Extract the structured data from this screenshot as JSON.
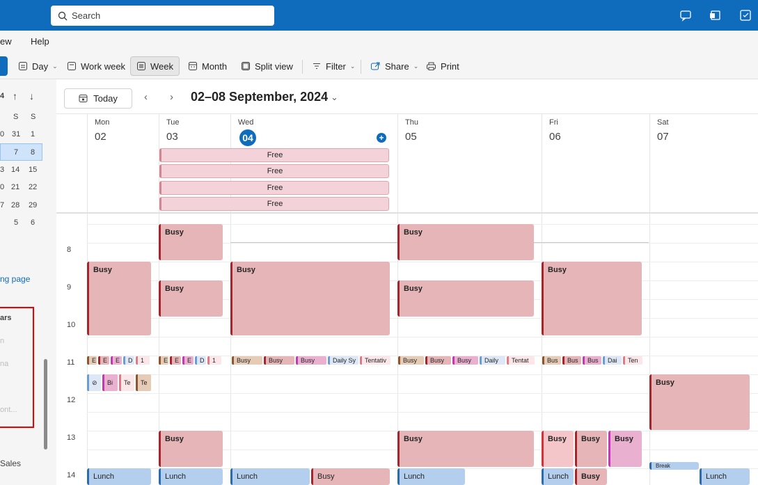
{
  "search": {
    "placeholder": "Search"
  },
  "menu": {
    "view_partial": "ew",
    "help": "Help"
  },
  "ribbon": {
    "day": "Day",
    "work_week": "Work week",
    "week": "Week",
    "month": "Month",
    "split_view": "Split view",
    "filter": "Filter",
    "share": "Share",
    "print": "Print"
  },
  "nav": {
    "today": "Today",
    "range": "02–08 September, 2024"
  },
  "minical": {
    "month_partial": "4",
    "headers": [
      "S",
      "S"
    ],
    "rows": [
      [
        "0",
        "31",
        "1"
      ],
      [
        "",
        "7",
        "8"
      ],
      [
        "3",
        "14",
        "15"
      ],
      [
        "0",
        "21",
        "22"
      ],
      [
        "7",
        "28",
        "29"
      ],
      [
        "",
        "5",
        "6"
      ]
    ]
  },
  "sidebar": {
    "link_partial": "ng page",
    "section_partial": "ars",
    "item1": "n",
    "item2": "na",
    "item3": "ont...",
    "sales": "Sales"
  },
  "days": [
    {
      "name": "Mon",
      "num": "02"
    },
    {
      "name": "Tue",
      "num": "03"
    },
    {
      "name": "Wed",
      "num": "04"
    },
    {
      "name": "Thu",
      "num": "05"
    },
    {
      "name": "Fri",
      "num": "06"
    },
    {
      "name": "Sat",
      "num": "07"
    }
  ],
  "allday_free": [
    "Free",
    "Free",
    "Free",
    "Free"
  ],
  "hours": [
    "8",
    "9",
    "10",
    "11",
    "12",
    "13",
    "14"
  ],
  "events": {
    "busy": "Busy",
    "lunch": "Lunch",
    "break": "Break",
    "chips_wed": [
      "Busy",
      "Busy",
      "Busy",
      "Daily Sy",
      "Tentativ"
    ],
    "chips_thu": [
      "Busy",
      "Busy",
      "Busy",
      "Daily",
      "Tentat"
    ],
    "chips_fri": [
      "Bus",
      "Bus",
      "Bus",
      "Dai",
      "Ten"
    ],
    "chips_mon": [
      "E",
      "E",
      "E",
      "D",
      "1"
    ],
    "chips_tue": [
      "E",
      "E",
      "E",
      "D",
      "1"
    ],
    "mon_row2": [
      "Bi",
      "Te",
      "Te"
    ]
  },
  "colors": {
    "brand": "#0f6cbd",
    "busy": "#e6b5b7",
    "busy_border": "#a4262c",
    "free": "#f3d3d9",
    "lunch": "#b4cfee"
  }
}
